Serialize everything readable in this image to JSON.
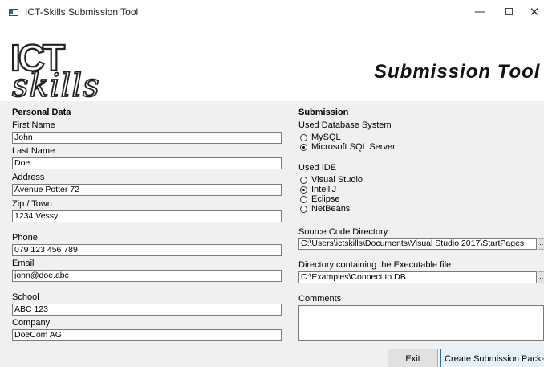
{
  "window": {
    "title": "ICT-Skills Submission Tool",
    "controls": {
      "minimize": "—",
      "close": "✕"
    }
  },
  "banner": {
    "logo_top": "ICT",
    "logo_bottom": "skills",
    "title": "Submission Tool"
  },
  "personal": {
    "heading": "Personal Data",
    "first_name": {
      "label": "First Name",
      "value": "John"
    },
    "last_name": {
      "label": "Last Name",
      "value": "Doe"
    },
    "address": {
      "label": "Address",
      "value": "Avenue Potter 72"
    },
    "zip_town": {
      "label": "Zip / Town",
      "value": "1234 Vessy"
    },
    "phone": {
      "label": "Phone",
      "value": "079 123 456 789"
    },
    "email": {
      "label": "Email",
      "value": "john@doe.abc"
    },
    "school": {
      "label": "School",
      "value": "ABC 123"
    },
    "company": {
      "label": "Company",
      "value": "DoeCom AG"
    }
  },
  "submission": {
    "heading": "Submission",
    "database": {
      "label": "Used Database System",
      "options": [
        "MySQL",
        "Microsoft SQL Server"
      ],
      "selected": "Microsoft SQL Server"
    },
    "ide": {
      "label": "Used IDE",
      "options": [
        "Visual Studio",
        "IntelliJ",
        "Eclipse",
        "NetBeans"
      ],
      "selected": "IntelliJ"
    },
    "source_dir": {
      "label": "Source Code Directory",
      "value": "C:\\Users\\ictskills\\Documents\\Visual Studio 2017\\StartPages",
      "browse": "..."
    },
    "exe_dir": {
      "label": "Directory containing the Executable file",
      "value": "C:\\Examples\\Connect to DB",
      "browse": "..."
    },
    "comments": {
      "label": "Comments",
      "value": ""
    }
  },
  "buttons": {
    "exit": "Exit",
    "create": "Create Submission Package"
  },
  "colors": {
    "panel_bg": "#f0f0f0",
    "accent_border": "#0078d7",
    "primary_button_bg": "#e5f1fb"
  }
}
